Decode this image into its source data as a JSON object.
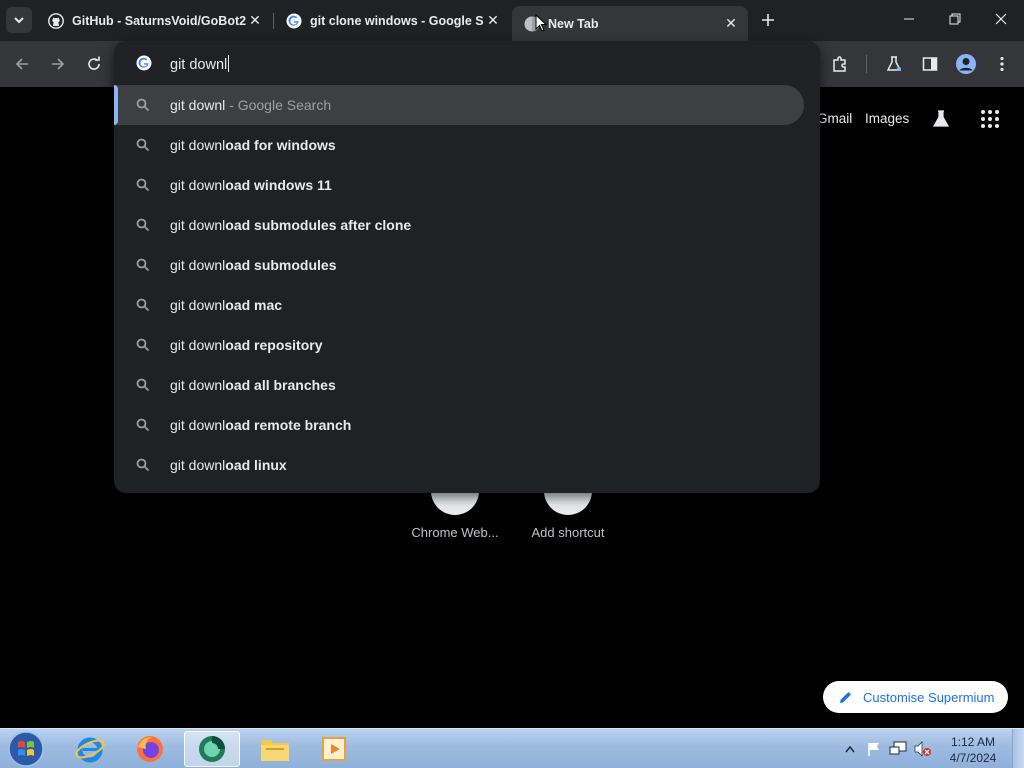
{
  "tabs": [
    {
      "title": "GitHub - SaturnsVoid/GoBot2",
      "favicon": "github-icon"
    },
    {
      "title": "git clone windows - Google Se",
      "favicon": "google-icon"
    },
    {
      "title": "New Tab",
      "favicon": "globe-icon",
      "active": true
    }
  ],
  "omnibox": {
    "typed": "git downl",
    "top_match": {
      "query": "git downl",
      "suffix": " - Google Search"
    },
    "suggestions": [
      {
        "typed": "git downl",
        "completion": "oad for windows"
      },
      {
        "typed": "git downl",
        "completion": "oad windows 11"
      },
      {
        "typed": "git downl",
        "completion": "oad submodules after clone"
      },
      {
        "typed": "git downl",
        "completion": "oad submodules"
      },
      {
        "typed": "git downl",
        "completion": "oad mac"
      },
      {
        "typed": "git downl",
        "completion": "oad repository"
      },
      {
        "typed": "git downl",
        "completion": "oad all branches"
      },
      {
        "typed": "git downl",
        "completion": "oad remote branch"
      },
      {
        "typed": "git downl",
        "completion": "oad linux"
      }
    ]
  },
  "ntp": {
    "links": {
      "gmail": "Gmail",
      "images": "Images"
    },
    "shortcuts": [
      {
        "label": "Chrome Web..."
      },
      {
        "label": "Add shortcut"
      }
    ],
    "customise_label": "Customise Supermium"
  },
  "taskbar": {
    "time": "1:12 AM",
    "date": "4/7/2024"
  },
  "colors": {
    "accent": "#8ab4f8",
    "customise_text": "#1a73e8",
    "dropdown_bg": "#202124",
    "selected_row": "#3c4043"
  }
}
